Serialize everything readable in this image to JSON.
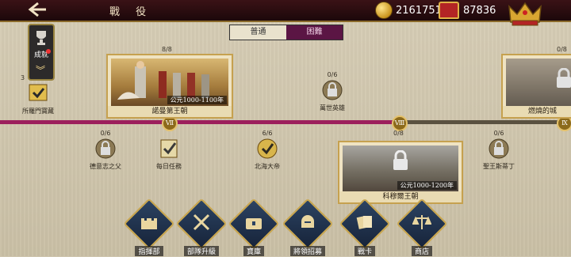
{
  "header": {
    "title": "戰 役",
    "gold": "2161751",
    "gems": "87836"
  },
  "side": {
    "label": "成就",
    "count": "3"
  },
  "tabs": {
    "normal": "普通",
    "hard": "困難"
  },
  "roman": {
    "r7": "Ⅶ",
    "r8": "Ⅷ",
    "r9": "Ⅸ"
  },
  "cards": {
    "normans": {
      "count": "8/8",
      "period": "公元1000-1100年",
      "name": "諾曼第王朝"
    },
    "fire": {
      "count": "0/8",
      "name": "燃燒的城"
    },
    "almoravid": {
      "count": "0/8",
      "period": "公元1000-1200年",
      "name": "科穆爾王朝"
    }
  },
  "nodes": {
    "boss_left": {
      "name": "所羅門寶藏",
      "count": "3"
    },
    "hero": {
      "count": "0/6",
      "name": "萬世英雄"
    },
    "dietrich": {
      "count": "0/6",
      "name": "德意志之父"
    },
    "daily": {
      "count": "",
      "name": "每日任務"
    },
    "north": {
      "count": "6/6",
      "name": "北海大帝"
    },
    "stephen": {
      "count": "0/6",
      "name": "聖王斯蒂丁"
    }
  },
  "bottom": [
    {
      "label": "指揮部",
      "icon": "castle-icon"
    },
    {
      "label": "部隊升級",
      "icon": "swords-icon"
    },
    {
      "label": "寶庫",
      "icon": "treasure-chest-icon"
    },
    {
      "label": "將領招募",
      "icon": "helmet-icon"
    },
    {
      "label": "戰卡",
      "icon": "cards-icon"
    },
    {
      "label": "商店",
      "icon": "scales-icon"
    }
  ],
  "colors": {
    "track_done": "#9c1f5c",
    "track_todo": "#5a5140",
    "gold": "#c6a14f"
  }
}
